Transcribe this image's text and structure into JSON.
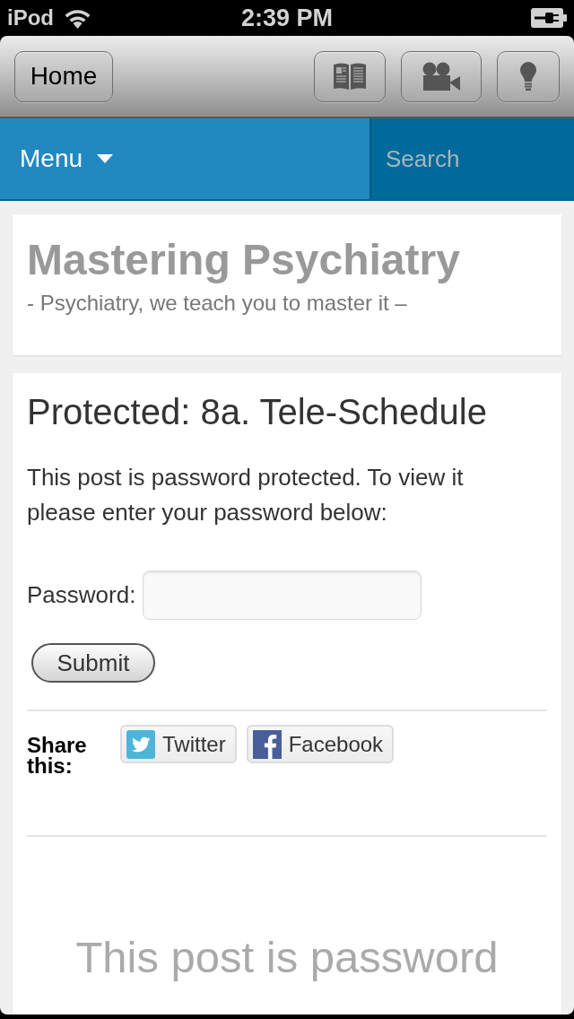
{
  "status_bar": {
    "carrier": "iPod",
    "time": "2:39 PM"
  },
  "toolbar": {
    "home_button": "Home"
  },
  "nav": {
    "menu": "Menu",
    "search": {
      "placeholder": "Search"
    }
  },
  "site_header": {
    "title": "Mastering Psychiatry",
    "tagline": "- Psychiatry, we teach you to master it –"
  },
  "post": {
    "title": "Protected: 8a. Tele-Schedule",
    "message": "This post is password protected. To view it please enter your password below:",
    "password_label": "Password:",
    "submit": "Submit",
    "share": {
      "label": "Share this:",
      "buttons": [
        {
          "kind": "twitter",
          "label": "Twitter"
        },
        {
          "kind": "facebook",
          "label": "Facebook"
        }
      ]
    },
    "teaser": "This post is password"
  }
}
